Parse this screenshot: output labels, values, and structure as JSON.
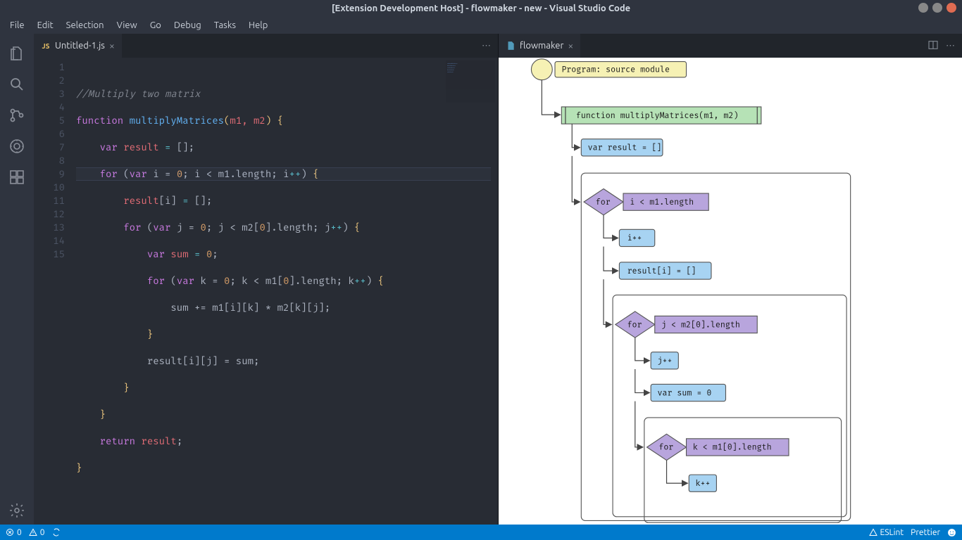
{
  "window_title": "[Extension Development Host] - flowmaker - new - Visual Studio Code",
  "menubar": [
    "File",
    "Edit",
    "Selection",
    "View",
    "Go",
    "Debug",
    "Tasks",
    "Help"
  ],
  "activity_icons": [
    "files",
    "search",
    "git",
    "debug",
    "extensions"
  ],
  "left_tab": {
    "label": "Untitled-1.js",
    "icon_text": "JS"
  },
  "right_tab": {
    "label": "flowmaker"
  },
  "line_numbers": [
    "1",
    "2",
    "3",
    "4",
    "5",
    "6",
    "7",
    "8",
    "9",
    "10",
    "11",
    "12",
    "13",
    "14",
    "15"
  ],
  "code_lines": {
    "l1_comment": "//Multiply two matrix",
    "l2_kw_fn": "function",
    "l2_name": "multiplyMatrices",
    "l2_args": "m1, m2",
    "l3_kw": "var",
    "l3_var": "result",
    "l4_kw_for": "for",
    "l4_kw_var": "var",
    "l4_init": "i = ",
    "l4_zero": "0",
    "l4_cond": "; i < m1.length; i",
    "l4_inc": "++",
    "l5_lhs": "result",
    "l5_idx": "[i]",
    "l6_kw_for": "for",
    "l6_kw_var": "var",
    "l6_init": "j = ",
    "l6_zero": "0",
    "l6_cond": "; j < m2[",
    "l6_z2": "0",
    "l6_cond2": "].length; j",
    "l6_inc": "++",
    "l7_kw": "var",
    "l7_var": "sum",
    "l7_zero": "0",
    "l8_kw_for": "for",
    "l8_kw_var": "var",
    "l8_init": "k = ",
    "l8_zero": "0",
    "l8_cond": "; k < m1[",
    "l8_z2": "0",
    "l8_cond2": "].length; k",
    "l8_inc": "++",
    "l9": "sum += m1[i][k] * m2[k][j];",
    "l11": "result[i][j] = sum;",
    "l14_kw": "return",
    "l14_var": "result"
  },
  "flow": {
    "program": "Program: source module",
    "func": "function multiplyMatrices(m1, m2)",
    "n1": "var result = []",
    "for1_kw": "for",
    "for1_cond": "i < m1.length",
    "inc1": "i++",
    "n2": "result[i] = []",
    "for2_kw": "for",
    "for2_cond": "j < m2[0].length",
    "inc2": "j++",
    "n3": "var sum = 0",
    "for3_kw": "for",
    "for3_cond": "k < m1[0].length",
    "inc3": "k++"
  },
  "status": {
    "errors": "0",
    "warnings": "0",
    "eslint": "ESLint",
    "prettier": "Prettier"
  },
  "colors": {
    "purple": "#b8a5dd",
    "blue": "#a7d3f2",
    "green": "#b6e2b6",
    "yellow": "#f6f1b4"
  }
}
